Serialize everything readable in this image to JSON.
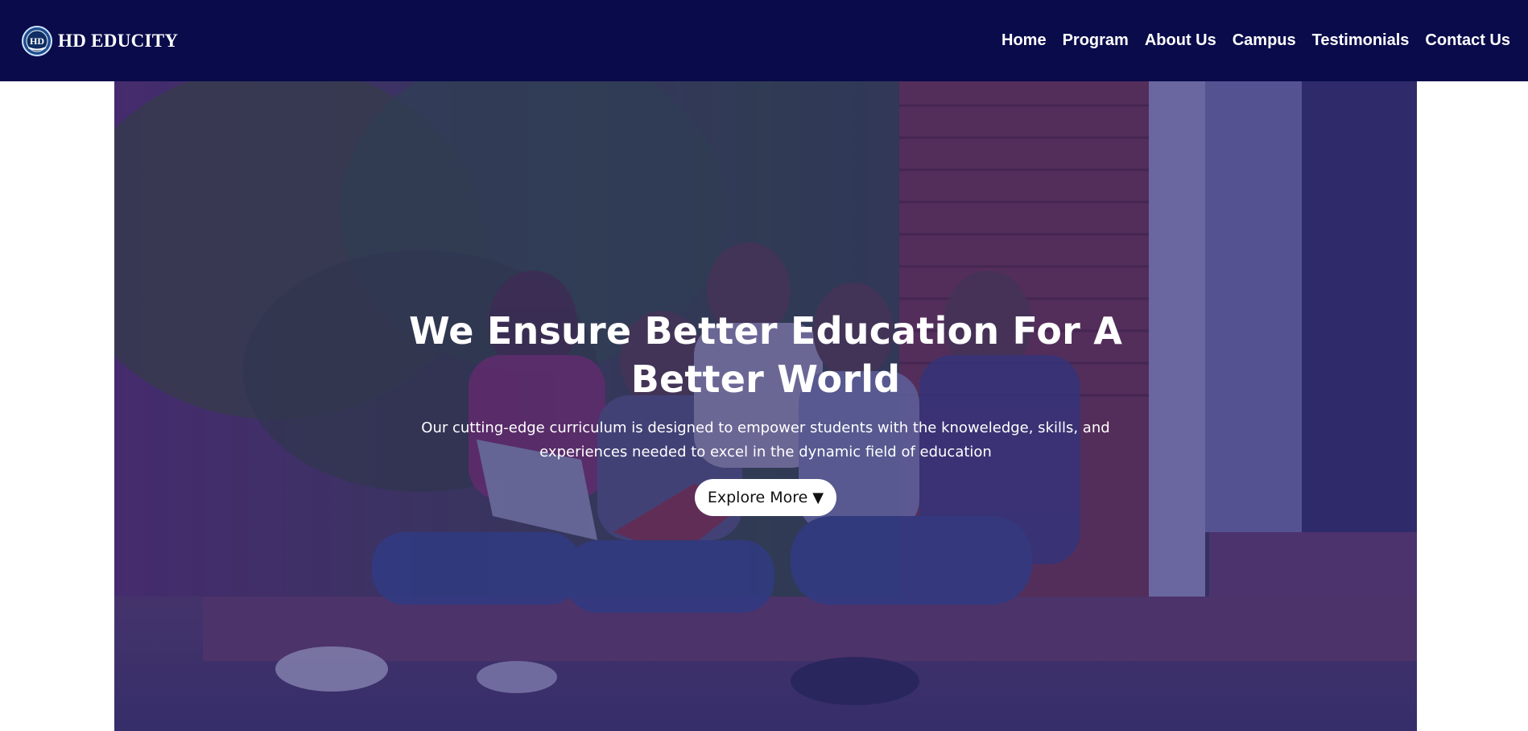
{
  "brand": {
    "logo_text": "HD",
    "name": "HD EDUCITY"
  },
  "nav": {
    "items": [
      {
        "label": "Home"
      },
      {
        "label": "Program"
      },
      {
        "label": "About Us"
      },
      {
        "label": "Campus"
      },
      {
        "label": "Testimonials"
      },
      {
        "label": "Contact Us"
      }
    ]
  },
  "hero": {
    "title": "We Ensure Better Education For A Better World",
    "subtitle": "Our cutting-edge curriculum is designed to empower students with the knoweledge, skills, and experiences needed to excel in the dynamic field of education",
    "button_label": "Explore More",
    "button_icon": "▼",
    "image_description_icon": "students-photo"
  },
  "colors": {
    "navbar_bg": "#0a0b4b",
    "overlay": "rgba(35,30,110,0.52)",
    "button_bg": "#ffffff"
  }
}
